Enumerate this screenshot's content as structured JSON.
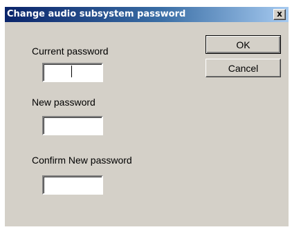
{
  "window": {
    "title": "Change audio subsystem password",
    "close_glyph": "x",
    "close_icon": "close-icon"
  },
  "fields": {
    "current_password": {
      "label": "Current password",
      "value": ""
    },
    "new_password": {
      "label": "New password",
      "value": ""
    },
    "confirm_password": {
      "label": "Confirm New password",
      "value": ""
    }
  },
  "buttons": {
    "ok_label": "OK",
    "cancel_label": "Cancel"
  },
  "colors": {
    "dialog_face": "#d4d0c8",
    "titlebar_start": "#0a246a",
    "titlebar_end": "#a6caf0"
  }
}
